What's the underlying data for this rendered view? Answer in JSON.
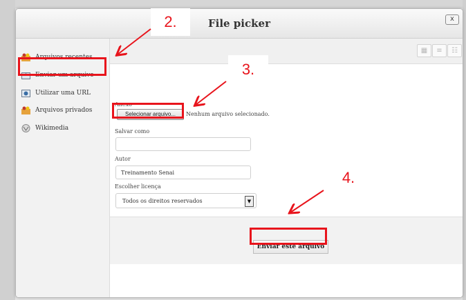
{
  "dialog": {
    "title": "File picker",
    "close_label": "x"
  },
  "sidebar": {
    "items": [
      {
        "label": "Arquivos recentes",
        "icon": "folder-users-icon"
      },
      {
        "label": "Enviar um arquivo",
        "icon": "upload-icon"
      },
      {
        "label": "Utilizar uma URL",
        "icon": "url-icon"
      },
      {
        "label": "Arquivos privados",
        "icon": "folder-users-icon"
      },
      {
        "label": "Wikimedia",
        "icon": "wikimedia-icon"
      }
    ]
  },
  "toolbar": {
    "view_icons": [
      "grid-view-icon",
      "list-view-icon",
      "tree-view-icon"
    ]
  },
  "form": {
    "attachment_label": "Anexo",
    "file_button_label": "Selecionar arquivo...",
    "file_status": "Nenhum arquivo selecionado.",
    "save_as_label": "Salvar como",
    "save_as_value": "",
    "author_label": "Autor",
    "author_value": "Treinamento Senai",
    "license_label": "Escolher licença",
    "license_value": "Todos os direitos reservados"
  },
  "footer": {
    "upload_button_label": "Enviar este arquivo"
  },
  "annotations": {
    "step2": "2.",
    "step3": "3.",
    "step4": "4.",
    "color": "#e8141c"
  }
}
